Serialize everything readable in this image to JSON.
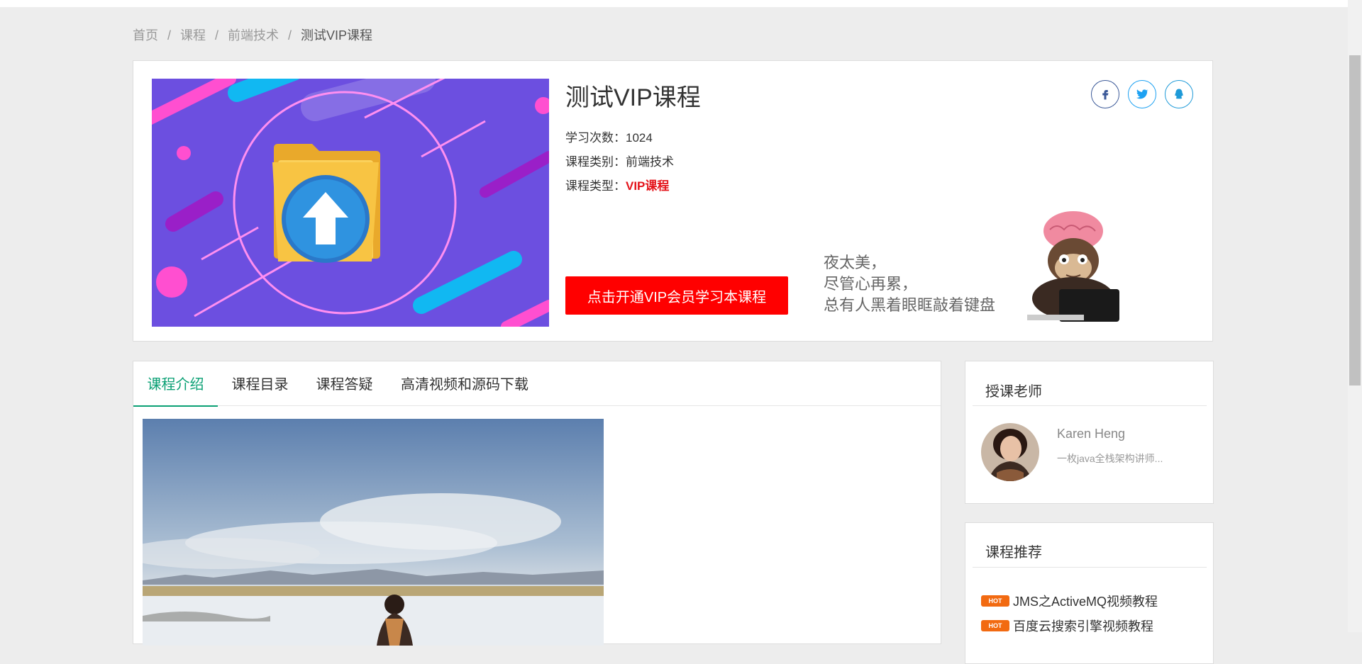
{
  "breadcrumb": {
    "items": [
      "首页",
      "课程",
      "前端技术"
    ],
    "separator": "/",
    "current": "测试VIP课程"
  },
  "course": {
    "title": "测试VIP课程",
    "learn_count_label": "学习次数：",
    "learn_count": "1024",
    "category_label": "课程类别：",
    "category": "前端技术",
    "type_label": "课程类型：",
    "type": "VIP课程",
    "vip_button": "点击开通VIP会员学习本课程",
    "slogan": [
      "夜太美，",
      "尽管心再累，",
      "总有人黑着眼眶敲着键盘"
    ]
  },
  "social": {
    "facebook_icon": "facebook-icon",
    "twitter_icon": "twitter-icon",
    "qq_icon": "qq-icon"
  },
  "tabs": [
    {
      "label": "课程介绍",
      "active": true
    },
    {
      "label": "课程目录",
      "active": false
    },
    {
      "label": "课程答疑",
      "active": false
    },
    {
      "label": "高清视频和源码下载",
      "active": false
    }
  ],
  "teacher_panel": {
    "title": "授课老师",
    "name": "Karen Heng",
    "desc": "一枚java全栈架构讲师..."
  },
  "recommend_panel": {
    "title": "课程推荐",
    "badge": "HOT",
    "items": [
      "JMS之ActiveMQ视频教程",
      "百度云搜索引擎视频教程"
    ]
  },
  "colors": {
    "accent_green": "#0aa074",
    "vip_red": "#e4141b",
    "button_red": "#ff0000",
    "hot_orange": "#f26a11"
  }
}
